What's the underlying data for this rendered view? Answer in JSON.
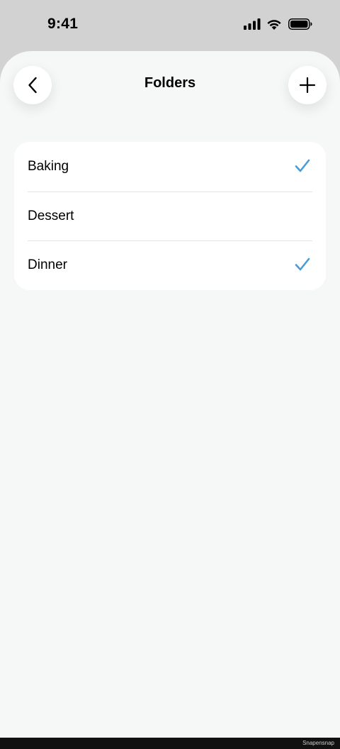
{
  "status_bar": {
    "time": "9:41",
    "icons": [
      "cellular-signal-icon",
      "wifi-icon",
      "battery-icon"
    ]
  },
  "header": {
    "title": "Folders",
    "back_icon": "chevron-left-icon",
    "add_icon": "plus-icon"
  },
  "folders": [
    {
      "label": "Baking",
      "checked": true
    },
    {
      "label": "Dessert",
      "checked": false
    },
    {
      "label": "Dinner",
      "checked": true
    }
  ],
  "footer": {
    "brand": "Snapensnap"
  },
  "colors": {
    "accent_check": "#4a9bd6",
    "sheet_background": "#f6f8f7",
    "backdrop": "#d2d2d2"
  }
}
